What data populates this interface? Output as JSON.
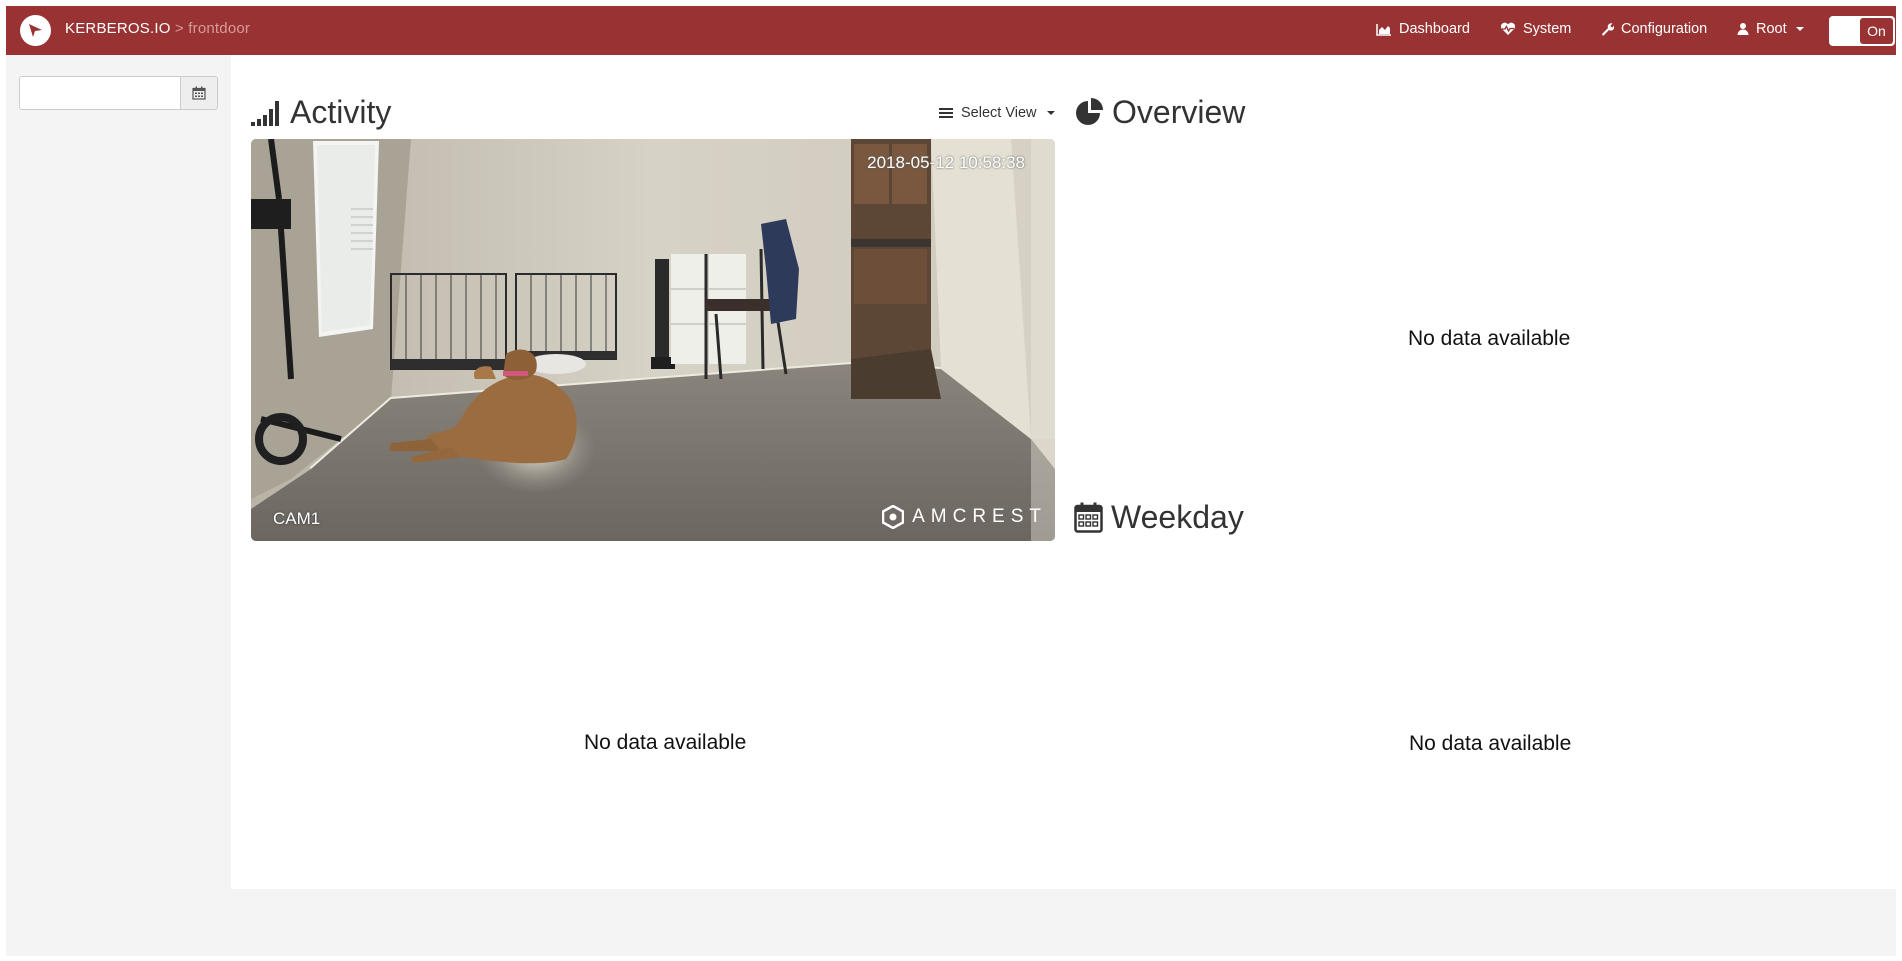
{
  "navbar": {
    "brand": "KERBEROS.IO",
    "brand_sub": " > frontdoor",
    "items": [
      {
        "label": "Dashboard",
        "icon": "area-chart-icon"
      },
      {
        "label": "System",
        "icon": "heartbeat-icon"
      },
      {
        "label": "Configuration",
        "icon": "wrench-icon"
      },
      {
        "label": "Root",
        "icon": "user-icon"
      }
    ],
    "toggle_label": "On"
  },
  "sidebar": {
    "date_value": "",
    "date_icon": "calendar-icon"
  },
  "activity": {
    "title": "Activity",
    "select_view_label": "Select View",
    "camera_timestamp": "2018-05-12 10:58:38",
    "camera_label": "CAM1",
    "camera_brand": "AMCREST",
    "no_data": "No data available"
  },
  "overview": {
    "title": "Overview",
    "no_data": "No data available"
  },
  "weekday": {
    "title": "Weekday",
    "no_data": "No data available"
  },
  "colors": {
    "navbar": "#993333",
    "sidebar": "#f4f4f4"
  }
}
